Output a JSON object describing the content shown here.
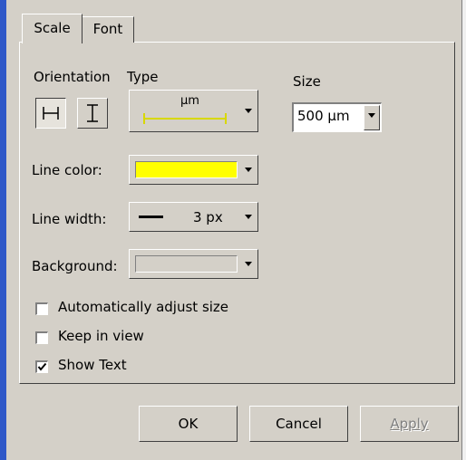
{
  "tabs": {
    "scale": "Scale",
    "font": "Font"
  },
  "scale": {
    "orientation_label": "Orientation",
    "type_label": "Type",
    "type_unit": "μm",
    "size_label": "Size",
    "size_value": "500 μm",
    "line_color_label": "Line color:",
    "line_color": "#ffff00",
    "line_width_label": "Line width:",
    "line_width_value": "3 px",
    "background_label": "Background:",
    "background_color": "#d4d0c8"
  },
  "options": [
    {
      "label": "Automatically adjust size",
      "checked": false
    },
    {
      "label": "Keep in view",
      "checked": false
    },
    {
      "label": "Show Text",
      "checked": true
    }
  ],
  "buttons": {
    "ok": "OK",
    "cancel": "Cancel",
    "apply": "Apply"
  }
}
